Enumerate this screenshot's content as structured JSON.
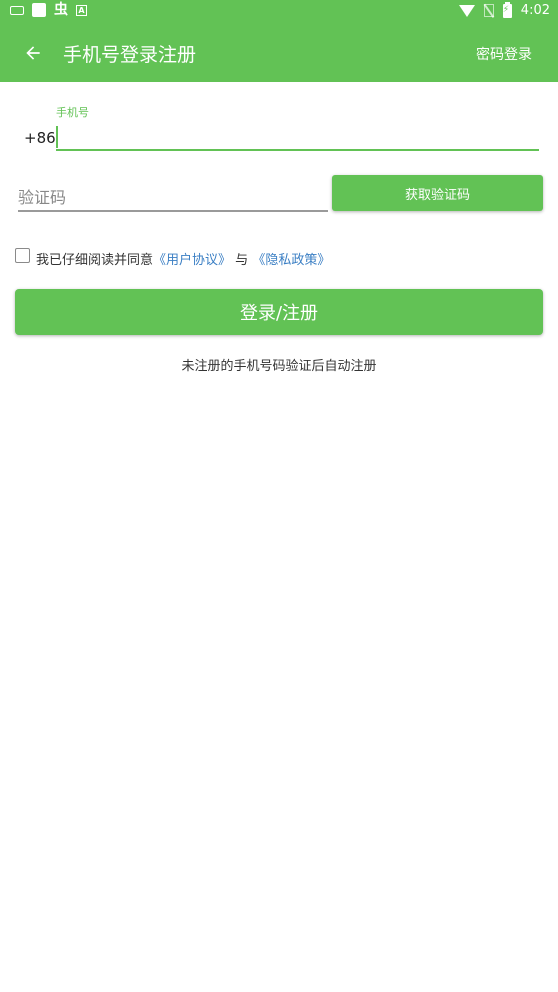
{
  "colors": {
    "primary": "#62c255",
    "link": "#3b7fc4"
  },
  "status_bar": {
    "time": "4:02",
    "left_icons": [
      "keyboard-icon",
      "square-icon",
      "bug-icon",
      "a-icon"
    ],
    "right_icons": [
      "wifi-icon",
      "no-sim-icon",
      "battery-charging-icon"
    ]
  },
  "toolbar": {
    "back_icon": "arrow-left-icon",
    "title": "手机号登录注册",
    "password_login": "密码登录"
  },
  "phone": {
    "label": "手机号",
    "country_code": "+86",
    "value": ""
  },
  "code": {
    "placeholder": "验证码",
    "value": "",
    "get_code_label": "获取验证码"
  },
  "agreement": {
    "checked": false,
    "text_prefix": "我已仔细阅读并同意",
    "user_agreement": "《用户协议》",
    "conjunction": "与",
    "privacy_policy": "《隐私政策》"
  },
  "login_button": "登录/注册",
  "hint": "未注册的手机号码验证后自动注册"
}
